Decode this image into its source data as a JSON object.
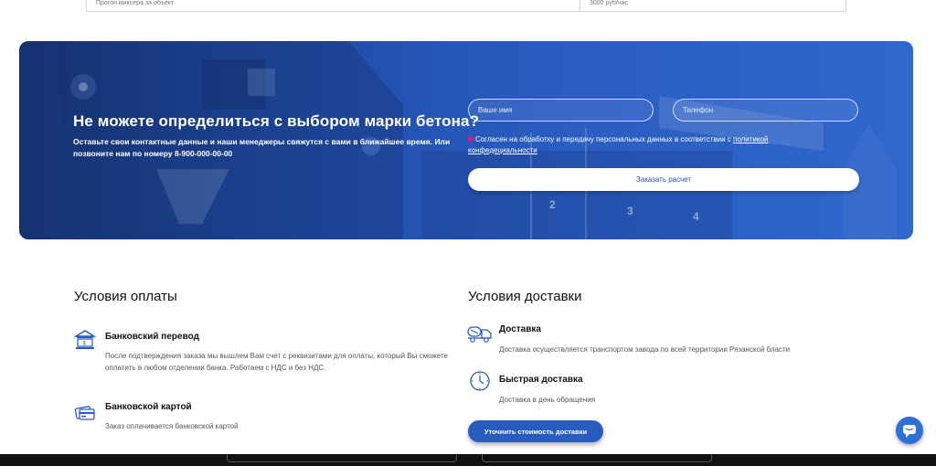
{
  "top_table": {
    "left_text": "Прогон миксера за объект",
    "right_text": "3000 руб/час"
  },
  "banner": {
    "title": "Не можете определиться с выбором марки бетона?",
    "subtitle": "Оставьте свои контактные данные и наши менеджеры свяжутся с вами в ближайшее время. Или позвоните нам по номеру 8-900-000-00-00",
    "name_placeholder": "Ваше имя",
    "phone_placeholder": "Телефон",
    "consent_text": "Согласен на обработку и передачу персональных данных в соответствии с ",
    "consent_link": "политикой конфедециальности",
    "order_button": "Заказать расчет",
    "checkbox_checked": true,
    "accent_color": "#2352b0"
  },
  "payment": {
    "title": "Условия оплаты",
    "items": [
      {
        "icon": "bank-icon",
        "title": "Банковский перевод",
        "text": "После подтверждения заказа мы вышлем Вам счет с реквизитами для оплаты, который Вы сможете оплатить в любом отделении банка. Работаем с НДС и без НДС."
      },
      {
        "icon": "credit-card-icon",
        "title": "Банковской картой",
        "text": "Заказ оплачивается банковской картой"
      }
    ]
  },
  "delivery": {
    "title": "Условия доставки",
    "items": [
      {
        "icon": "concrete-truck-icon",
        "title": "Доставка",
        "text": "Доставка осуществляется транспортом завода по всей территории Рязанской бласти"
      },
      {
        "icon": "clock-icon",
        "title": "Быстрая доставка",
        "text": "Доставка в день обращения"
      }
    ],
    "button": "Уточнить стоимость доставки"
  },
  "chat": {
    "icon": "chat-icon"
  }
}
